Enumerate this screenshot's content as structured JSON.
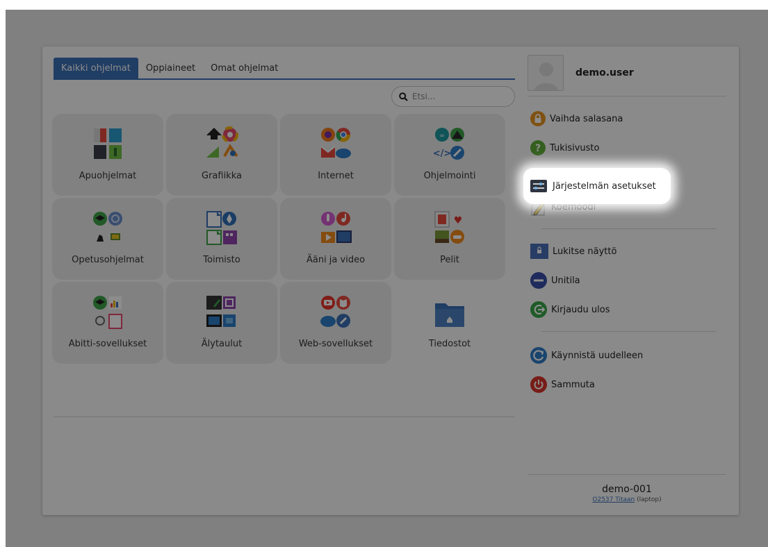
{
  "tabs": [
    {
      "label": "Kaikki ohjelmat",
      "active": true
    },
    {
      "label": "Oppiaineet",
      "active": false
    },
    {
      "label": "Omat ohjelmat",
      "active": false
    }
  ],
  "search": {
    "placeholder": "Etsi..."
  },
  "categories": [
    {
      "label": "Apuohjelmat",
      "icon": "accessories-icon"
    },
    {
      "label": "Grafiikka",
      "icon": "graphics-icon"
    },
    {
      "label": "Internet",
      "icon": "internet-icon"
    },
    {
      "label": "Ohjelmointi",
      "icon": "programming-icon"
    },
    {
      "label": "Opetusohjelmat",
      "icon": "education-icon"
    },
    {
      "label": "Toimisto",
      "icon": "office-icon"
    },
    {
      "label": "Ääni ja video",
      "icon": "audio-video-icon"
    },
    {
      "label": "Pelit",
      "icon": "games-icon"
    },
    {
      "label": "Abitti-sovellukset",
      "icon": "abitti-icon"
    },
    {
      "label": "Älytaulut",
      "icon": "smartboard-icon"
    },
    {
      "label": "Web-sovellukset",
      "icon": "webapps-icon"
    },
    {
      "label": "Tiedostot",
      "icon": "folder-home-icon"
    }
  ],
  "user": {
    "name": "demo.user"
  },
  "menu": {
    "change_password": "Vaihda salasana",
    "support": "Tukisivusto",
    "system_settings": "Järjestelmän asetukset",
    "exam_mode": "Koemoodi",
    "lock_screen": "Lukitse näyttö",
    "sleep": "Unitila",
    "logout": "Kirjaudu ulos",
    "restart": "Käynnistä uudelleen",
    "shutdown": "Sammuta"
  },
  "host": {
    "name": "demo-001",
    "link": "O2537 Titaan",
    "type": "(laptop)"
  },
  "colors": {
    "accent": "#3b6fb6",
    "lock": "#e8941f",
    "help": "#5fae3a",
    "sleep": "#3a4fa8",
    "logout": "#3aa64a",
    "restart": "#2e7dc9",
    "shutdown": "#d9342b"
  }
}
